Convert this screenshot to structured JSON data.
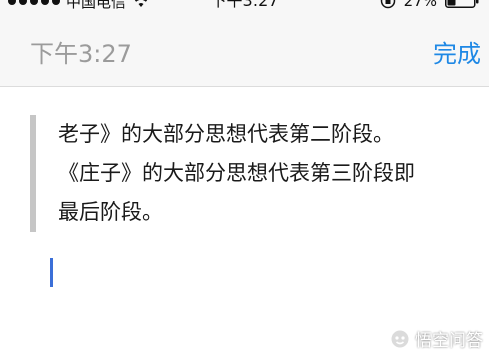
{
  "status_bar": {
    "carrier": "中国电信",
    "time": "下午3:27",
    "battery": "27%",
    "icons": [
      "signal-dots-icon",
      "wifi-icon",
      "rotation-lock-icon",
      "battery-icon"
    ]
  },
  "nav": {
    "title_time": "下午3:27",
    "done_label": "完成"
  },
  "editor": {
    "quote_lines": [
      "老子》的大部分思想代表第二阶段。",
      "《庄子》的大部分思想代表第三阶段即",
      "最后阶段。"
    ]
  },
  "watermark": {
    "text": "悟空问答",
    "icon": "wukong-logo-icon"
  },
  "colors": {
    "accent": "#1e88e5",
    "cursor": "#3b6fd8",
    "quote_bar": "#c6c6c6",
    "nav_background": "#f7f7f7",
    "muted_text": "#9b9b9b"
  }
}
